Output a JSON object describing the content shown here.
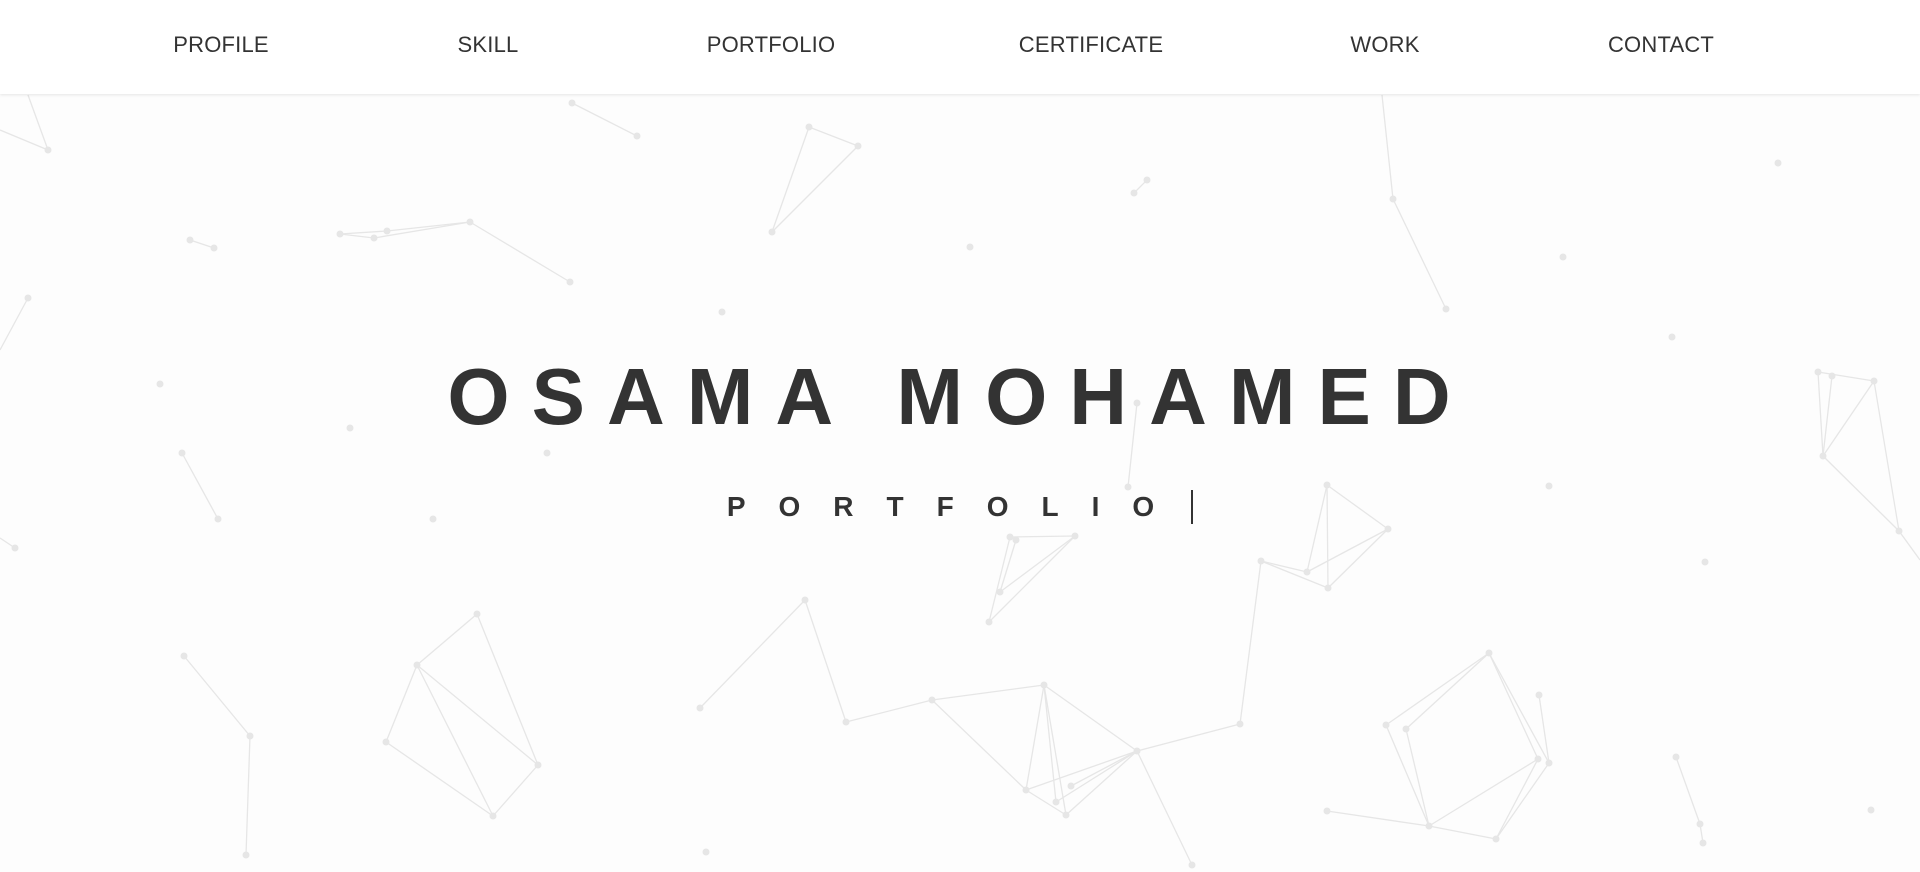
{
  "nav": {
    "items": [
      {
        "label": "PROFILE"
      },
      {
        "label": "SKILL"
      },
      {
        "label": "PORTFOLIO"
      },
      {
        "label": "CERTIFICATE"
      },
      {
        "label": "WORK"
      },
      {
        "label": "CONTACT"
      }
    ]
  },
  "hero": {
    "title": "OSAMA MOHAMED",
    "subtitle": "PORTFOLIO"
  },
  "colors": {
    "text": "#333333",
    "background": "#fdfdfd",
    "navbar": "#ffffff",
    "network": "#e6e6e6"
  }
}
